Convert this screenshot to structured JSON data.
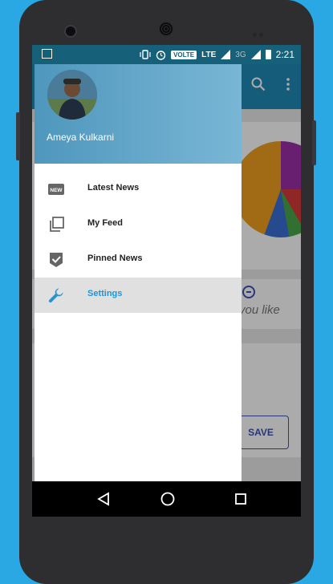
{
  "statusbar": {
    "volte": "VOLTE",
    "lte": "LTE",
    "network_3g": "3G",
    "time": "2:21"
  },
  "drawer": {
    "user_name": "Ameya Kulkarni",
    "items": [
      {
        "label": "Latest News",
        "icon": "new-badge-icon"
      },
      {
        "label": "My Feed",
        "icon": "copy-pages-icon"
      },
      {
        "label": "Pinned News",
        "icon": "checkmark-shield-icon"
      },
      {
        "label": "Settings",
        "icon": "wrench-icon"
      }
    ],
    "active_item": "Settings",
    "new_badge_text": "NEW"
  },
  "background_app": {
    "text_fragment": "you like",
    "save_label": "SAVE"
  },
  "colors": {
    "app_primary": "#1e8ab7",
    "statusbar": "#16607a",
    "active_item_text": "#2196d3",
    "backdrop": "#29a8e4"
  }
}
